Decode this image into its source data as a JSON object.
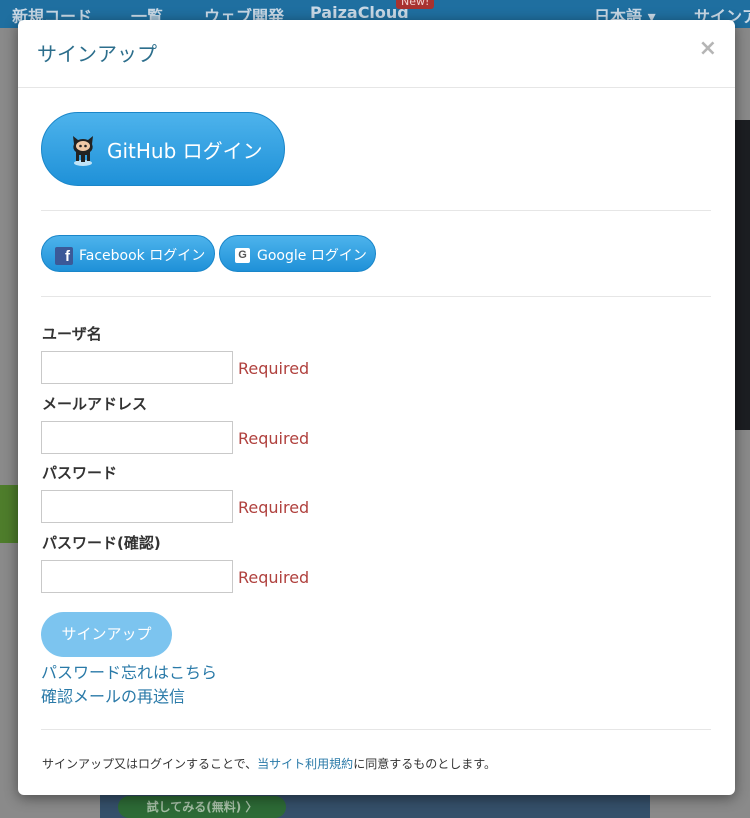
{
  "background": {
    "nav": {
      "new_code": "新規コード",
      "list": "一覧",
      "web_dev": "ウェブ開発",
      "paiza_cloud": "PaizaCloud",
      "new_badge": "New!",
      "language": "日本語",
      "signup": "サインア"
    },
    "try_button": "試してみる(無料) 〉"
  },
  "modal": {
    "title": "サインアップ",
    "close_symbol": "×",
    "github_button": "GitHub ログイン",
    "facebook_button": "Facebook ログイン",
    "google_button": "Google ログイン",
    "fields": [
      {
        "label": "ユーザ名",
        "value": "",
        "hint": "Required"
      },
      {
        "label": "メールアドレス",
        "value": "",
        "hint": "Required"
      },
      {
        "label": "パスワード",
        "value": "",
        "hint": "Required"
      },
      {
        "label": "パスワード(確認)",
        "value": "",
        "hint": "Required"
      }
    ],
    "signup_button": "サインアップ",
    "forgot_password_link": "パスワード忘れはこちら",
    "resend_confirmation_link": "確認メールの再送信",
    "terms": {
      "before": "サインアップ又はログインすることで、",
      "link": "当サイト利用規約",
      "after": "に同意するものとします。"
    }
  },
  "colors": {
    "accent": "#2a7aa8",
    "button_blue": "#1f91d8",
    "required_red": "#b0413e",
    "disabled_button": "#7cc4ef"
  }
}
